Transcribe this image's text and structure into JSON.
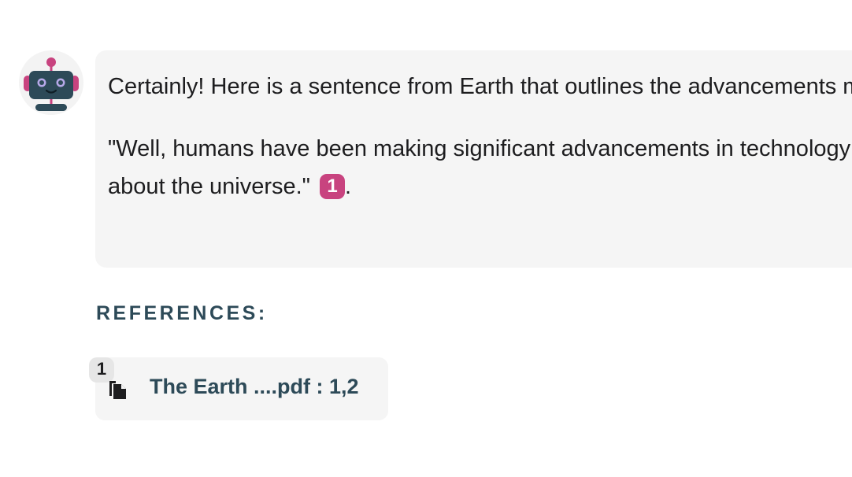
{
  "assistant": {
    "avatar_icon": "robot-icon"
  },
  "message": {
    "line1": "Certainly! Here is a sentence from Earth that outlines the advancements made by humans:",
    "quote_line1": "\"Well, humans have been making significant advancements in technology and science, learning more",
    "quote_line2": "about the universe.\"",
    "citation_number": "1",
    "trailing": "."
  },
  "references": {
    "heading": "REFERENCES:",
    "items": [
      {
        "number": "1",
        "icon": "documents-icon",
        "title": "The Earth ....pdf : 1,2"
      }
    ]
  },
  "colors": {
    "accent": "#c8437f",
    "heading": "#2d4a58",
    "bubble_bg": "#f5f5f5",
    "robot_body": "#2d4a58"
  }
}
